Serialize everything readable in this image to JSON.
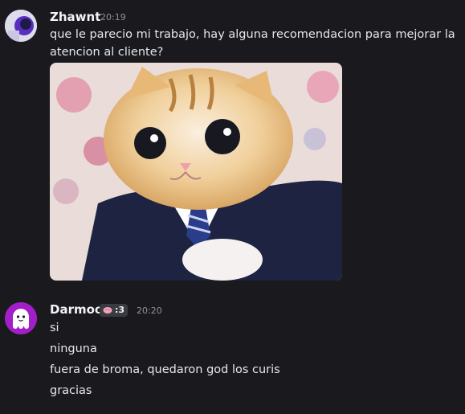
{
  "messages": [
    {
      "author": "Zhawnt",
      "time": "20:19",
      "lines": [
        "que le parecio mi trabajo, hay alguna recomendacion para mejorar la",
        "atencion al cliente?"
      ],
      "attachment_icon": "kitten-in-suit-image"
    },
    {
      "author": "Darmoo",
      "tag": ":3",
      "tag_icon": "pink-blob-icon",
      "time": "20:20",
      "lines": [
        "si",
        "ninguna",
        "fuera de broma, quedaron god los curis",
        "gracias"
      ]
    }
  ],
  "colors": {
    "background": "#1a1a1e",
    "avatar2": "#a11ec8"
  }
}
